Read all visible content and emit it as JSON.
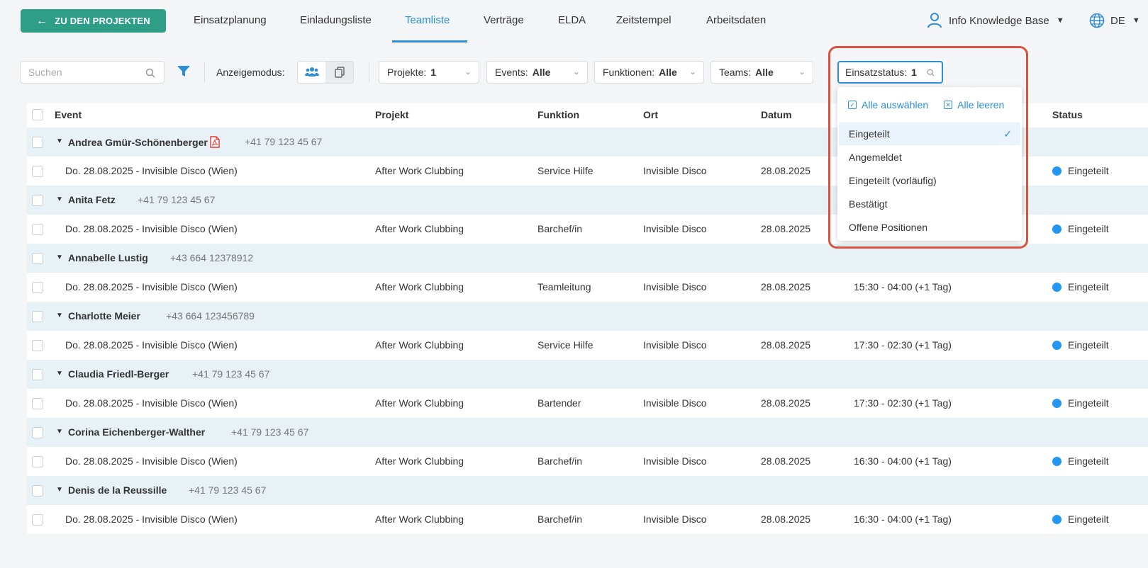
{
  "topbar": {
    "back_button": "ZU DEN PROJEKTEN",
    "tabs": [
      {
        "label": "Einsatzplanung"
      },
      {
        "label": "Einladungsliste"
      },
      {
        "label": "Teamliste"
      },
      {
        "label": "Verträge"
      },
      {
        "label": "ELDA"
      },
      {
        "label": "Zeitstempel"
      },
      {
        "label": "Arbeitsdaten"
      }
    ],
    "active_tab": "Teamliste",
    "user": "Info Knowledge Base",
    "language": "DE"
  },
  "filters": {
    "search_placeholder": "Suchen",
    "mode_label": "Anzeigemodus:",
    "projekte": {
      "label": "Projekte:",
      "value": "1"
    },
    "events": {
      "label": "Events:",
      "value": "Alle"
    },
    "funktionen": {
      "label": "Funktionen:",
      "value": "Alle"
    },
    "teams": {
      "label": "Teams:",
      "value": "Alle"
    },
    "einsatzstatus": {
      "label": "Einsatzstatus:",
      "value": "1"
    }
  },
  "table": {
    "headers": {
      "event": "Event",
      "projekt": "Projekt",
      "funktion": "Funktion",
      "ort": "Ort",
      "datum": "Datum",
      "status": "Status"
    },
    "groups": [
      {
        "name": "Andrea Gmür-Schönenberger",
        "phone": "+41 79 123 45 67",
        "has_pdf": true,
        "item": {
          "event": "Do. 28.08.2025 - Invisible Disco (Wien)",
          "projekt": "After Work Clubbing",
          "funktion": "Service Hilfe",
          "ort": "Invisible Disco",
          "datum": "28.08.2025",
          "zeit": "",
          "status": "Eingeteilt"
        }
      },
      {
        "name": "Anita Fetz",
        "phone": "+41 79 123 45 67",
        "item": {
          "event": "Do. 28.08.2025 - Invisible Disco (Wien)",
          "projekt": "After Work Clubbing",
          "funktion": "Barchef/in",
          "ort": "Invisible Disco",
          "datum": "28.08.2025",
          "zeit": "",
          "status": "Eingeteilt"
        }
      },
      {
        "name": "Annabelle Lustig",
        "phone": "+43 664 12378912",
        "item": {
          "event": "Do. 28.08.2025 - Invisible Disco (Wien)",
          "projekt": "After Work Clubbing",
          "funktion": "Teamleitung",
          "ort": "Invisible Disco",
          "datum": "28.08.2025",
          "zeit": "15:30 - 04:00 (+1 Tag)",
          "status": "Eingeteilt"
        }
      },
      {
        "name": "Charlotte Meier",
        "phone": "+43 664 123456789",
        "item": {
          "event": "Do. 28.08.2025 - Invisible Disco (Wien)",
          "projekt": "After Work Clubbing",
          "funktion": "Service Hilfe",
          "ort": "Invisible Disco",
          "datum": "28.08.2025",
          "zeit": "17:30 - 02:30 (+1 Tag)",
          "status": "Eingeteilt"
        }
      },
      {
        "name": "Claudia Friedl-Berger",
        "phone": "+41 79 123 45 67",
        "item": {
          "event": "Do. 28.08.2025 - Invisible Disco (Wien)",
          "projekt": "After Work Clubbing",
          "funktion": "Bartender",
          "ort": "Invisible Disco",
          "datum": "28.08.2025",
          "zeit": "17:30 - 02:30 (+1 Tag)",
          "status": "Eingeteilt"
        }
      },
      {
        "name": "Corina Eichenberger-Walther",
        "phone": "+41 79 123 45 67",
        "item": {
          "event": "Do. 28.08.2025 - Invisible Disco (Wien)",
          "projekt": "After Work Clubbing",
          "funktion": "Barchef/in",
          "ort": "Invisible Disco",
          "datum": "28.08.2025",
          "zeit": "16:30 - 04:00 (+1 Tag)",
          "status": "Eingeteilt"
        }
      },
      {
        "name": "Denis de la Reussille",
        "phone": "+41 79 123 45 67",
        "item": {
          "event": "Do. 28.08.2025 - Invisible Disco (Wien)",
          "projekt": "After Work Clubbing",
          "funktion": "Barchef/in",
          "ort": "Invisible Disco",
          "datum": "28.08.2025",
          "zeit": "16:30 - 04:00 (+1 Tag)",
          "status": "Eingeteilt"
        }
      }
    ]
  },
  "status_dropdown": {
    "select_all": "Alle auswählen",
    "clear_all": "Alle leeren",
    "options": [
      {
        "label": "Eingeteilt",
        "selected": true
      },
      {
        "label": "Angemeldet",
        "selected": false
      },
      {
        "label": "Eingeteilt (vorläufig)",
        "selected": false
      },
      {
        "label": "Bestätigt",
        "selected": false
      },
      {
        "label": "Offene Positionen",
        "selected": false
      }
    ]
  },
  "colors": {
    "accent": "#2e8fd8",
    "primary_green": "#2e9e86",
    "status_dot": "#2196f3",
    "highlight": "#d9533f"
  }
}
